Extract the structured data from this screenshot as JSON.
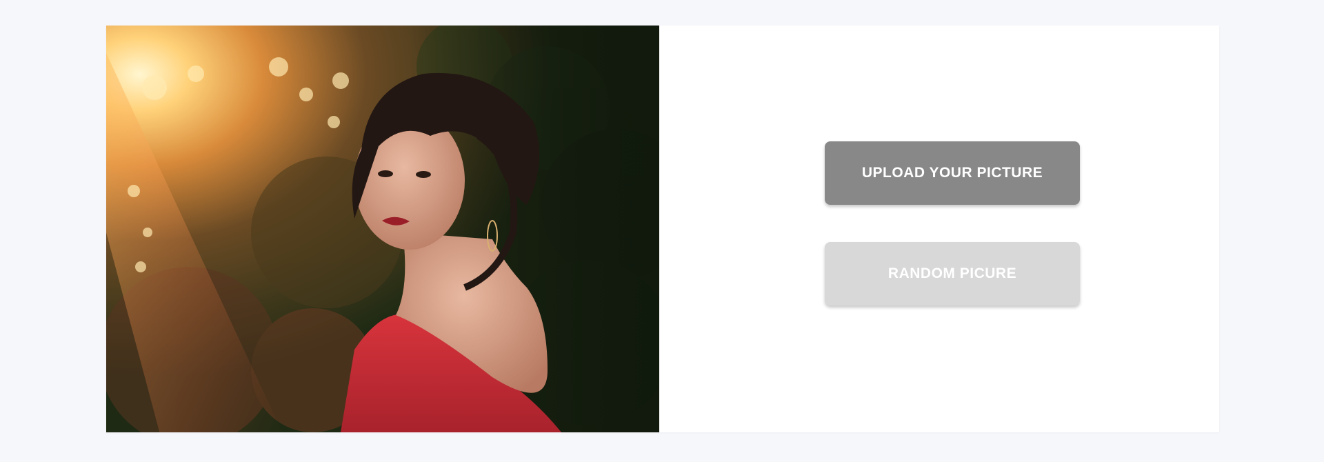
{
  "photo": {
    "icon": "portrait-photo",
    "alt": ""
  },
  "actions": {
    "upload_label": "UPLOAD YOUR PICTURE",
    "random_label": "RANDOM PICURE"
  },
  "colors": {
    "page_background": "#f6f7fb",
    "card_background": "#ffffff",
    "upload_button": "#888888",
    "random_button": "#d8d8d8",
    "button_text": "#ffffff"
  }
}
